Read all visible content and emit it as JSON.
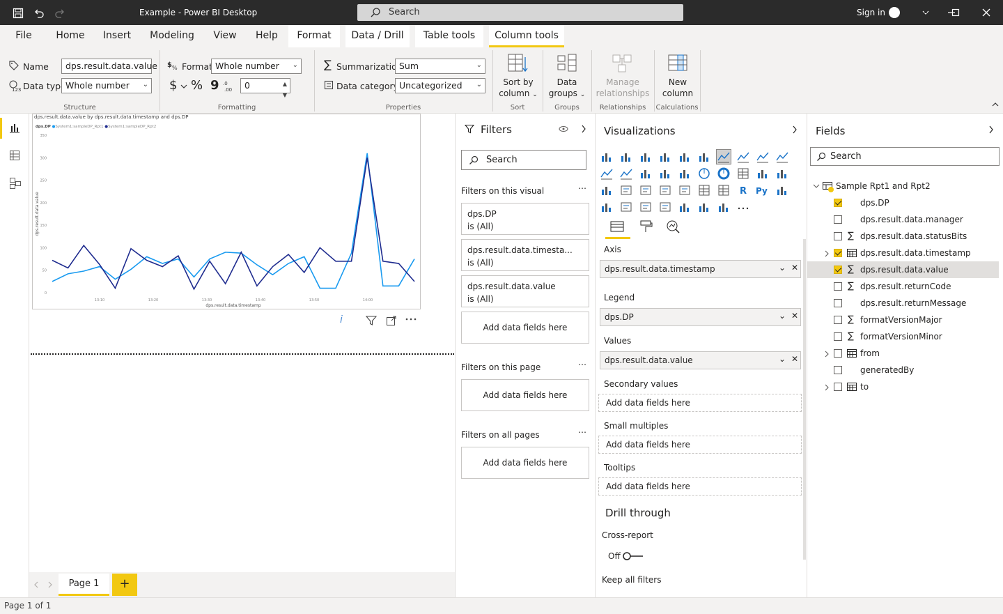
{
  "window": {
    "title": "Example - Power BI Desktop",
    "search_label": "Search",
    "sign_in": "Sign in"
  },
  "menu": {
    "tabs": [
      "File",
      "Home",
      "Insert",
      "Modeling",
      "View",
      "Help",
      "Format",
      "Data / Drill",
      "Table tools",
      "Column tools"
    ]
  },
  "ribbon": {
    "name_label": "Name",
    "name_value": "dps.result.data.value",
    "datatype_label": "Data type",
    "datatype_value": "Whole number",
    "format_label": "Format",
    "format_value": "Whole number",
    "currency_symbol": "$",
    "percent_symbol": "%",
    "comma_symbol": "9",
    "decimals_value": "0",
    "summarization_label": "Summarization",
    "summarization_value": "Sum",
    "datacategory_label": "Data category",
    "datacategory_value": "Uncategorized",
    "sort_by_column": [
      "Sort by",
      "column"
    ],
    "data_groups": [
      "Data",
      "groups"
    ],
    "manage_relationships": [
      "Manage",
      "relationships"
    ],
    "new_column": [
      "New",
      "column"
    ],
    "groups": {
      "structure": "Structure",
      "formatting": "Formatting",
      "properties": "Properties",
      "sort": "Sort",
      "groups": "Groups",
      "relationships": "Relationships",
      "calculations": "Calculations"
    }
  },
  "visual": {
    "title": "dps.result.data.value by dps.result.data.timestamp and dps.DP",
    "legend_title": "dps.DP",
    "xlabel": "dps.result.data.timestamp",
    "ylabel": "dps.result.data.value"
  },
  "chart_data": {
    "type": "line",
    "title": "dps.result.data.value by dps.result.data.timestamp and dps.DP",
    "xlabel": "dps.result.data.timestamp",
    "ylabel": "dps.result.data.value",
    "ylim": [
      0,
      350
    ],
    "yticks": [
      "0",
      "50",
      "100",
      "150",
      "200",
      "250",
      "300",
      "350"
    ],
    "xticks": [
      "13:10",
      "13:20",
      "13:30",
      "13:40",
      "13:50",
      "14:00"
    ],
    "legend_placement": "top-left",
    "x": [
      0,
      1,
      2,
      3,
      4,
      5,
      6,
      7,
      8,
      9,
      10,
      11,
      12,
      13,
      14,
      15,
      16,
      17,
      18,
      19,
      20,
      21,
      22
    ],
    "series": [
      {
        "name": "System1:sampleDP_Rpt1",
        "color": "#1a9bf0",
        "values": [
          25,
          42,
          48,
          58,
          30,
          52,
          80,
          65,
          75,
          35,
          75,
          90,
          88,
          62,
          40,
          65,
          80,
          10,
          10,
          88,
          310,
          15,
          15,
          75
        ]
      },
      {
        "name": "System1:sampleDP_Rpt2",
        "color": "#1f2c8f",
        "values": [
          72,
          55,
          105,
          63,
          10,
          98,
          72,
          58,
          82,
          8,
          70,
          20,
          90,
          15,
          58,
          85,
          45,
          100,
          70,
          70,
          300,
          70,
          65,
          25
        ]
      }
    ]
  },
  "visual_actions": {
    "info": "i"
  },
  "pages": {
    "current": "Page 1",
    "add": "+"
  },
  "status": {
    "text": "Page 1 of 1"
  },
  "filters": {
    "title": "Filters",
    "search": "Search",
    "on_visual": "Filters on this visual",
    "cards": [
      {
        "field": "dps.DP",
        "state": "is (All)"
      },
      {
        "field": "dps.result.data.timesta...",
        "state": "is (All)"
      },
      {
        "field": "dps.result.data.value",
        "state": "is (All)"
      }
    ],
    "add_here": "Add data fields here",
    "on_page": "Filters on this page",
    "on_all": "Filters on all pages"
  },
  "viz": {
    "title": "Visualizations",
    "wells": {
      "axis_label": "Axis",
      "axis_value": "dps.result.data.timestamp",
      "legend_label": "Legend",
      "legend_value": "dps.DP",
      "values_label": "Values",
      "values_value": "dps.result.data.value",
      "secondary_label": "Secondary values",
      "small_multiples_label": "Small multiples",
      "tooltips_label": "Tooltips",
      "add_here": "Add data fields here"
    },
    "drill_title": "Drill through",
    "cross_report": "Cross-report",
    "toggle_state": "Off",
    "keep_filters": "Keep all filters"
  },
  "fields": {
    "title": "Fields",
    "search": "Search",
    "table_name": "Sample Rpt1 and Rpt2",
    "items": [
      {
        "label": "dps.DP",
        "checked": true,
        "icon": "none"
      },
      {
        "label": "dps.result.data.manager",
        "checked": false,
        "icon": "none"
      },
      {
        "label": "dps.result.data.statusBits",
        "checked": false,
        "icon": "sigma"
      },
      {
        "label": "dps.result.data.timestamp",
        "checked": true,
        "icon": "calendar"
      },
      {
        "label": "dps.result.data.value",
        "checked": true,
        "icon": "sigma"
      },
      {
        "label": "dps.result.returnCode",
        "checked": false,
        "icon": "sigma"
      },
      {
        "label": "dps.result.returnMessage",
        "checked": false,
        "icon": "none"
      },
      {
        "label": "formatVersionMajor",
        "checked": false,
        "icon": "sigma"
      },
      {
        "label": "formatVersionMinor",
        "checked": false,
        "icon": "sigma"
      },
      {
        "label": "from",
        "checked": false,
        "icon": "calendar"
      },
      {
        "label": "generatedBy",
        "checked": false,
        "icon": "none"
      },
      {
        "label": "to",
        "checked": false,
        "icon": "calendar"
      }
    ]
  },
  "colors": {
    "accent": "#f2c811",
    "titlebar": "#2b2b2b",
    "series1": "#1a9bf0",
    "series2": "#1f2c8f"
  }
}
